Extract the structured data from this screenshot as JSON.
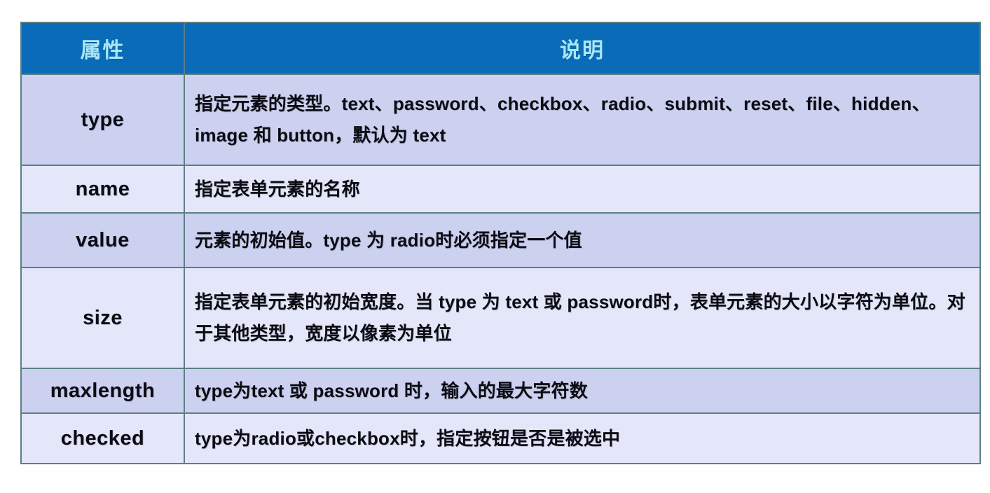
{
  "table": {
    "headers": {
      "attribute": "属性",
      "description": "说明"
    },
    "rows": [
      {
        "attribute": "type",
        "description": "指定元素的类型。text、password、checkbox、radio、submit、reset、file、hidden、image 和 button，默认为 text"
      },
      {
        "attribute": "name",
        "description": "指定表单元素的名称"
      },
      {
        "attribute": "value",
        "description": "元素的初始值。type 为 radio时必须指定一个值"
      },
      {
        "attribute": "size",
        "description": "指定表单元素的初始宽度。当 type 为 text 或 password时，表单元素的大小以字符为单位。对于其他类型，宽度以像素为单位"
      },
      {
        "attribute": "maxlength",
        "description": "type为text 或 password 时，输入的最大字符数"
      },
      {
        "attribute": "checked",
        "description": "type为radio或checkbox时，指定按钮是否是被选中"
      }
    ]
  },
  "colors": {
    "header_background": "#0a6cb8",
    "header_text": "#a8e7f7",
    "row_shade_dark": "#ccd1f0",
    "row_shade_light": "#e4e7f9",
    "border": "#5c7f86",
    "body_text": "#0b0b12",
    "page_background": "#ffffff"
  }
}
